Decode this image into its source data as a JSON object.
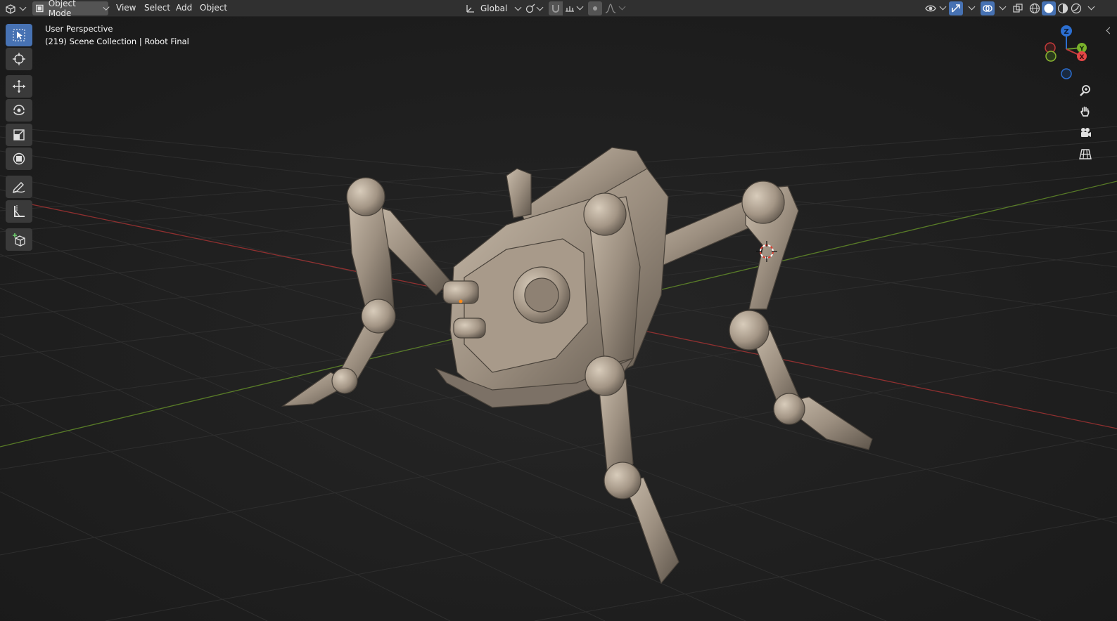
{
  "header": {
    "editor_type_icon": "3d-viewport-icon",
    "mode_label": "Object Mode",
    "menus": [
      "View",
      "Select",
      "Add",
      "Object"
    ],
    "transform_orientation": "Global"
  },
  "viewport": {
    "view_name": "User Perspective",
    "collection_info": "(219) Scene Collection | Robot Final",
    "gizmo_axes": [
      "Z",
      "Y",
      "X"
    ]
  },
  "toolbar": {
    "tools": [
      "select-box-icon",
      "cursor-icon",
      "move-icon",
      "rotate-icon",
      "scale-icon",
      "transform-icon",
      "annotate-icon",
      "measure-icon",
      "add-cube-icon"
    ]
  },
  "navigation": {
    "buttons": [
      "zoom-icon",
      "hand-pan-icon",
      "camera-icon",
      "grid-icon"
    ]
  },
  "colors": {
    "header_bg": "#303030",
    "viewport_bg": "#1d1d1d",
    "active_tool": "#4772b3",
    "x_axis": "#c23a3a",
    "y_axis": "#6a9a2a",
    "z_axis": "#2c6fd1",
    "model": "#9c8f80"
  }
}
